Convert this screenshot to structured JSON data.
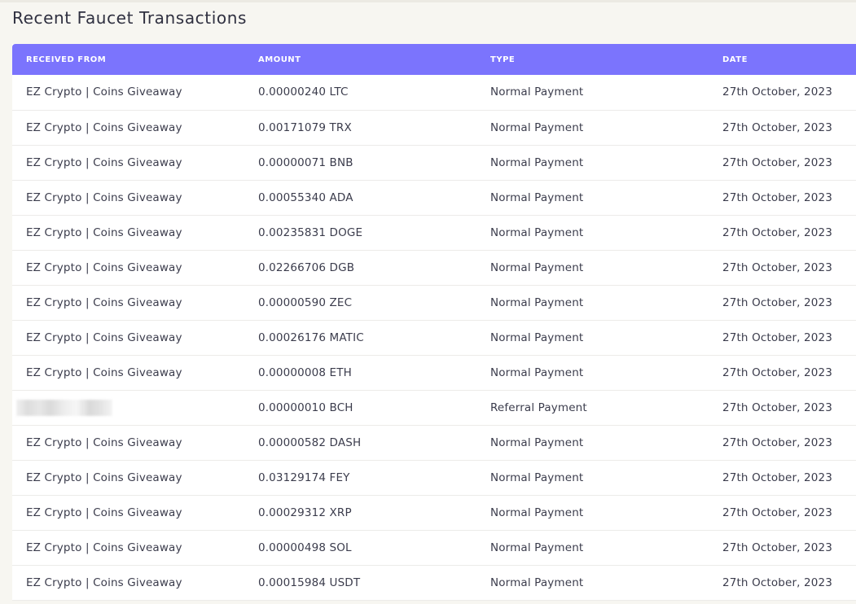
{
  "page": {
    "title": "Recent Faucet Transactions"
  },
  "table": {
    "headers": {
      "received_from": "RECEIVED FROM",
      "amount": "AMOUNT",
      "type": "TYPE",
      "date": "DATE"
    },
    "rows": [
      {
        "from": "EZ Crypto | Coins Giveaway",
        "amount": "0.00000240 LTC",
        "type": "Normal Payment",
        "date": "27th October, 2023"
      },
      {
        "from": "EZ Crypto | Coins Giveaway",
        "amount": "0.00171079 TRX",
        "type": "Normal Payment",
        "date": "27th October, 2023"
      },
      {
        "from": "EZ Crypto | Coins Giveaway",
        "amount": "0.00000071 BNB",
        "type": "Normal Payment",
        "date": "27th October, 2023"
      },
      {
        "from": "EZ Crypto | Coins Giveaway",
        "amount": "0.00055340 ADA",
        "type": "Normal Payment",
        "date": "27th October, 2023"
      },
      {
        "from": "EZ Crypto | Coins Giveaway",
        "amount": "0.00235831 DOGE",
        "type": "Normal Payment",
        "date": "27th October, 2023"
      },
      {
        "from": "EZ Crypto | Coins Giveaway",
        "amount": "0.02266706 DGB",
        "type": "Normal Payment",
        "date": "27th October, 2023"
      },
      {
        "from": "EZ Crypto | Coins Giveaway",
        "amount": "0.00000590 ZEC",
        "type": "Normal Payment",
        "date": "27th October, 2023"
      },
      {
        "from": "EZ Crypto | Coins Giveaway",
        "amount": "0.00026176 MATIC",
        "type": "Normal Payment",
        "date": "27th October, 2023"
      },
      {
        "from": "EZ Crypto | Coins Giveaway",
        "amount": "0.00000008 ETH",
        "type": "Normal Payment",
        "date": "27th October, 2023"
      },
      {
        "from": "",
        "amount": "0.00000010 BCH",
        "type": "Referral Payment",
        "date": "27th October, 2023"
      },
      {
        "from": "EZ Crypto | Coins Giveaway",
        "amount": "0.00000582 DASH",
        "type": "Normal Payment",
        "date": "27th October, 2023"
      },
      {
        "from": "EZ Crypto | Coins Giveaway",
        "amount": "0.03129174 FEY",
        "type": "Normal Payment",
        "date": "27th October, 2023"
      },
      {
        "from": "EZ Crypto | Coins Giveaway",
        "amount": "0.00029312 XRP",
        "type": "Normal Payment",
        "date": "27th October, 2023"
      },
      {
        "from": "EZ Crypto | Coins Giveaway",
        "amount": "0.00000498 SOL",
        "type": "Normal Payment",
        "date": "27th October, 2023"
      },
      {
        "from": "EZ Crypto | Coins Giveaway",
        "amount": "0.00015984 USDT",
        "type": "Normal Payment",
        "date": "27th October, 2023"
      }
    ]
  },
  "colors": {
    "header_bg": "#7b74fd",
    "page_bg": "#f7f6f1",
    "table_bg": "#ffffff"
  }
}
